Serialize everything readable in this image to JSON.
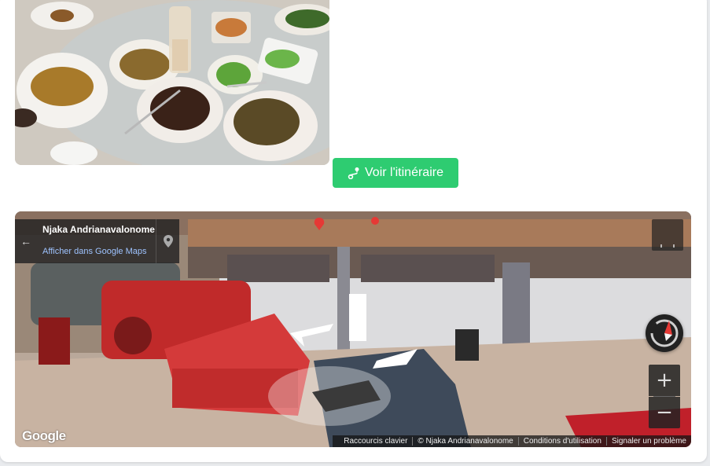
{
  "colors": {
    "accent": "#2ecc71",
    "card_bg": "#ffffff",
    "page_bg": "#e9ebee"
  },
  "route_button": {
    "label": "Voir l'itinéraire",
    "icon": "route-icon"
  },
  "street_view": {
    "place_name": "Njaka Andrianavalonome",
    "view_in_maps": "Afficher dans Google Maps",
    "back_icon": "arrow-left-icon",
    "pin_icon": "map-pin-icon",
    "zoom_in": "+",
    "zoom_out": "−",
    "logo": "Google",
    "footer": {
      "shortcuts": "Raccourcis clavier",
      "copyright": "© Njaka Andrianavalonome",
      "terms": "Conditions d'utilisation",
      "report": "Signaler un problème"
    }
  }
}
